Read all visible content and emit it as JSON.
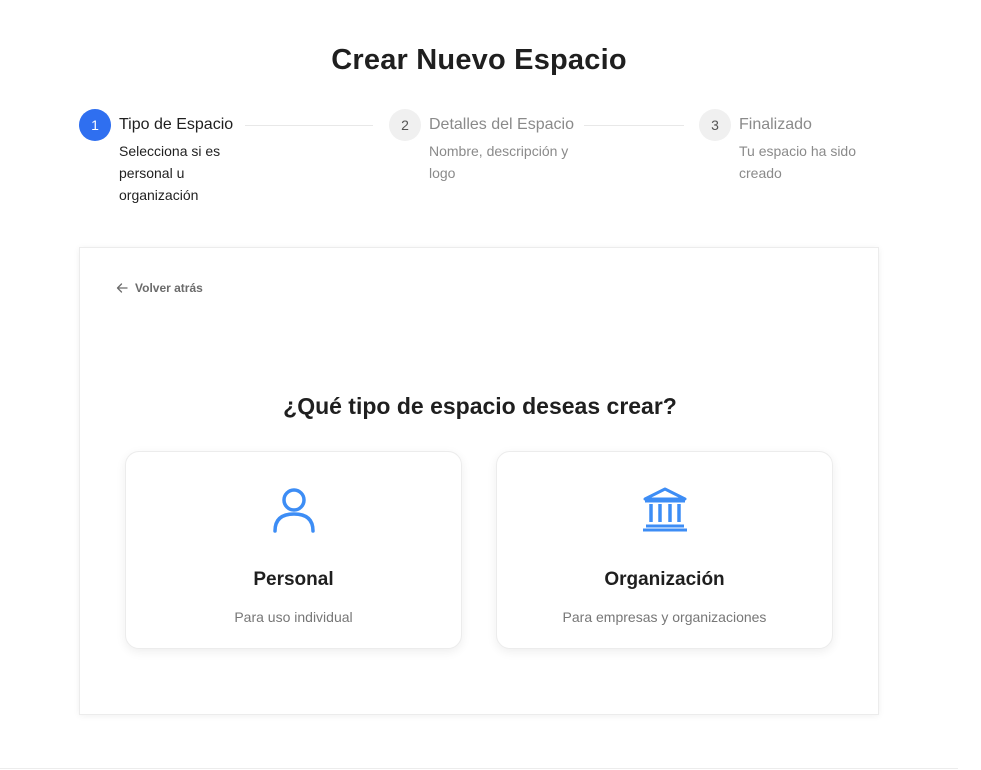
{
  "page": {
    "title": "Crear Nuevo Espacio"
  },
  "stepper": {
    "steps": [
      {
        "number": "1",
        "title": "Tipo de Espacio",
        "description": "Selecciona si es personal u organización",
        "status": "active"
      },
      {
        "number": "2",
        "title": "Detalles del Espacio",
        "description": "Nombre, descripción y logo",
        "status": "pending"
      },
      {
        "number": "3",
        "title": "Finalizado",
        "description": "Tu espacio ha sido creado",
        "status": "pending"
      }
    ]
  },
  "card": {
    "back_label": "Volver atrás",
    "question": "¿Qué tipo de espacio deseas crear?",
    "options": [
      {
        "icon": "user-icon",
        "title": "Personal",
        "description": "Para uso individual"
      },
      {
        "icon": "bank-icon",
        "title": "Organización",
        "description": "Para empresas y organizaciones"
      }
    ]
  },
  "colors": {
    "accent": "#2f6ff0",
    "icon": "#3d8df5",
    "text": "#1f1f1f",
    "muted": "#8a8a8a"
  }
}
